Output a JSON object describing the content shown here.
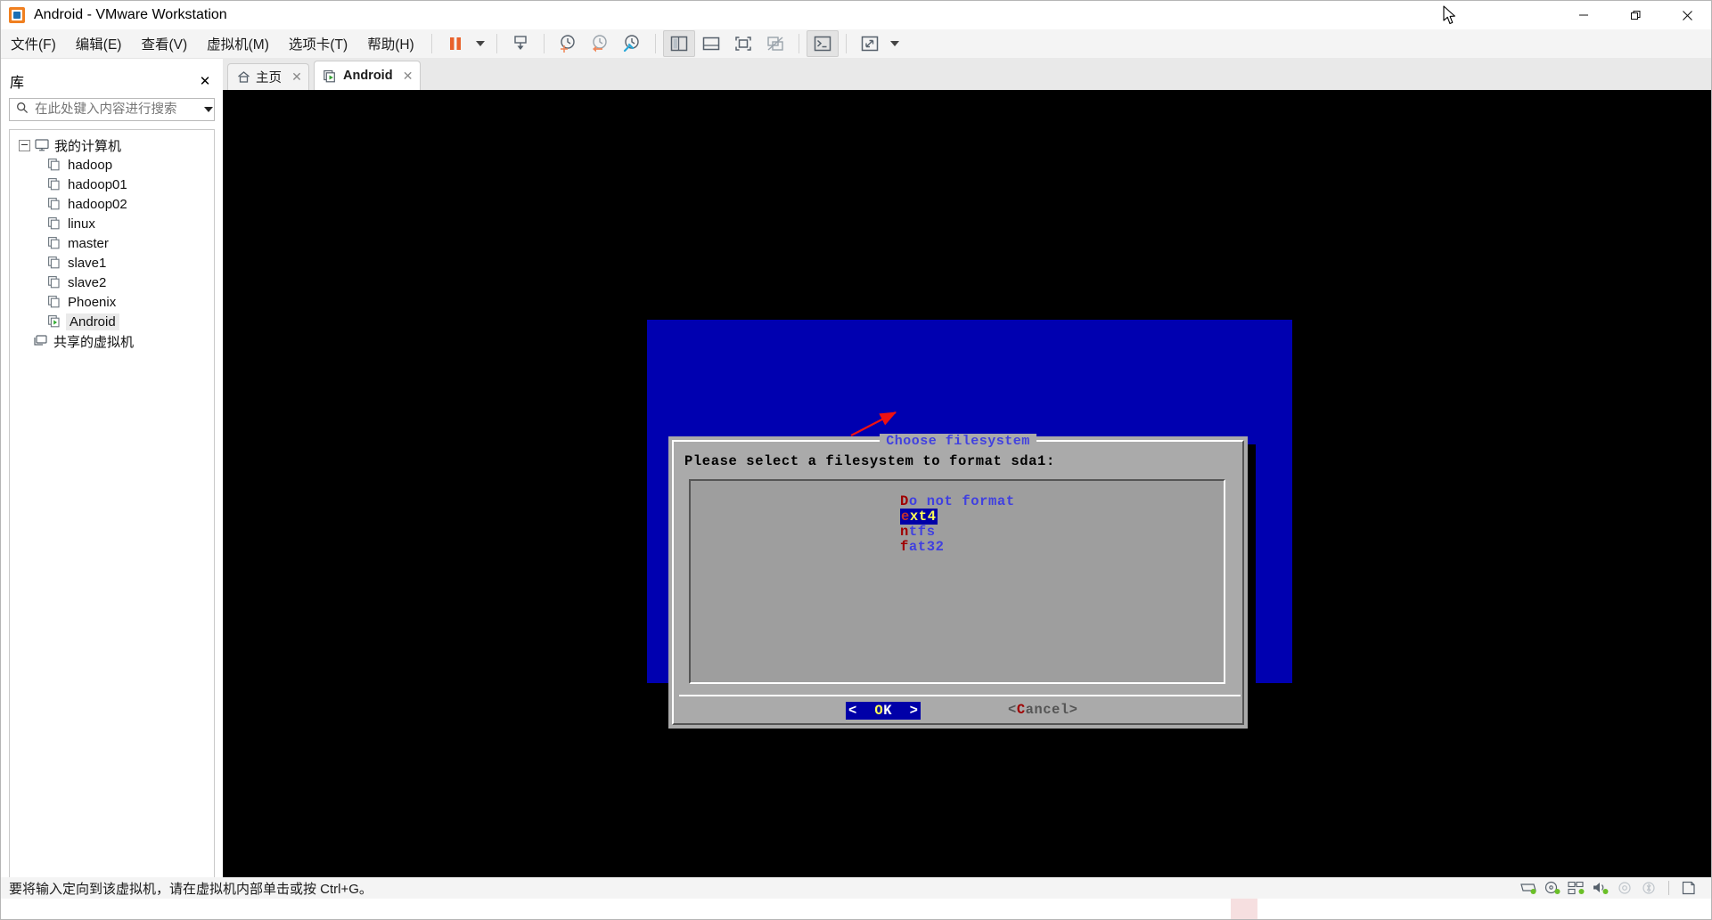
{
  "window": {
    "title": "Android - VMware Workstation",
    "app_icon": "vmware-logo-icon",
    "controls": {
      "minimize": "—",
      "maximize": "❐",
      "close": "✕"
    }
  },
  "menubar": {
    "items": [
      {
        "label": "文件(F)",
        "mnemonic": "F",
        "name": "menu-file"
      },
      {
        "label": "编辑(E)",
        "mnemonic": "E",
        "name": "menu-edit"
      },
      {
        "label": "查看(V)",
        "mnemonic": "V",
        "name": "menu-view"
      },
      {
        "label": "虚拟机(M)",
        "mnemonic": "M",
        "name": "menu-vm"
      },
      {
        "label": "选项卡(T)",
        "mnemonic": "T",
        "name": "menu-tabs"
      },
      {
        "label": "帮助(H)",
        "mnemonic": "H",
        "name": "menu-help"
      }
    ],
    "toolbar_icons": [
      "suspend-icon",
      "suspend-dropdown-caret-icon",
      "power-on-icon",
      "snapshot-take-icon",
      "snapshot-revert-icon",
      "snapshot-manager-icon",
      "show-library-icon",
      "show-thumbnail-bar-icon",
      "full-screen-icon",
      "unity-mode-icon",
      "console-icon",
      "stretch-guest-icon",
      "stretch-dropdown-caret-icon"
    ]
  },
  "library": {
    "title": "库",
    "close_label": "✕",
    "search": {
      "placeholder": "在此处键入内容进行搜索",
      "value": "",
      "icon": "search-icon",
      "dropdown_icon": "chevron-down-icon"
    },
    "tree": [
      {
        "label": "我的计算机",
        "icon": "my-computer-icon",
        "depth": 0,
        "expanded": true,
        "selected": false
      },
      {
        "label": "hadoop",
        "icon": "vm-icon",
        "depth": 1,
        "selected": false
      },
      {
        "label": "hadoop01",
        "icon": "vm-icon",
        "depth": 1,
        "selected": false
      },
      {
        "label": "hadoop02",
        "icon": "vm-icon",
        "depth": 1,
        "selected": false
      },
      {
        "label": "linux",
        "icon": "vm-icon",
        "depth": 1,
        "selected": false
      },
      {
        "label": "master",
        "icon": "vm-icon",
        "depth": 1,
        "selected": false
      },
      {
        "label": "slave1",
        "icon": "vm-icon",
        "depth": 1,
        "selected": false
      },
      {
        "label": "slave2",
        "icon": "vm-icon",
        "depth": 1,
        "selected": false
      },
      {
        "label": "Phoenix",
        "icon": "vm-icon",
        "depth": 1,
        "selected": false
      },
      {
        "label": "Android",
        "icon": "vm-running-icon",
        "depth": 1,
        "selected": true
      },
      {
        "label": "共享的虚拟机",
        "icon": "shared-vms-icon",
        "depth": 0,
        "selected": false
      }
    ]
  },
  "tabs": [
    {
      "label": "主页",
      "icon": "home-icon",
      "active": false,
      "close_label": "✕"
    },
    {
      "label": "Android",
      "icon": "vm-running-icon",
      "active": true,
      "close_label": "✕"
    }
  ],
  "guest_dialog": {
    "title": "Choose filesystem",
    "prompt": "Please select a filesystem to format sda1:",
    "options": [
      {
        "hotkey": "D",
        "rest": "o not format",
        "selected": false
      },
      {
        "hotkey": "e",
        "rest": "xt4",
        "selected": true
      },
      {
        "hotkey": "n",
        "rest": "tfs",
        "selected": false
      },
      {
        "hotkey": "f",
        "rest": "at32",
        "selected": false
      }
    ],
    "buttons": [
      {
        "prefix": "<  ",
        "hotkey": "O",
        "rest": "K",
        "suffix": "  >",
        "name": "ok-button",
        "selected": true
      },
      {
        "prefix": "<",
        "hotkey": "C",
        "rest": "ancel",
        "suffix": ">",
        "name": "cancel-button",
        "selected": false
      }
    ],
    "colors": {
      "backdrop": "#0000b0",
      "dialog_bg": "#aaaaaa",
      "list_bg": "#9e9e9e",
      "title_text": "#4040e0",
      "option_text": "#4040e0",
      "hotkey_text": "#a00000",
      "selection_bg": "#0000a8",
      "selection_text": "#ffff55"
    },
    "annotation": {
      "type": "red-arrow",
      "color": "#ee1111",
      "points_to": "ext4"
    }
  },
  "statusbar": {
    "message": "要将输入定向到该虚拟机，请在虚拟机内部单击或按 Ctrl+G。",
    "devices": [
      {
        "name": "hard-disk-icon",
        "active": true
      },
      {
        "name": "cd-dvd-icon",
        "active": true
      },
      {
        "name": "network-adapter-icon",
        "active": true
      },
      {
        "name": "sound-card-icon",
        "active": true
      },
      {
        "name": "printer-icon",
        "active": false
      },
      {
        "name": "bluetooth-icon",
        "active": false
      },
      {
        "name": "usb-device-icon",
        "active": false
      }
    ]
  }
}
